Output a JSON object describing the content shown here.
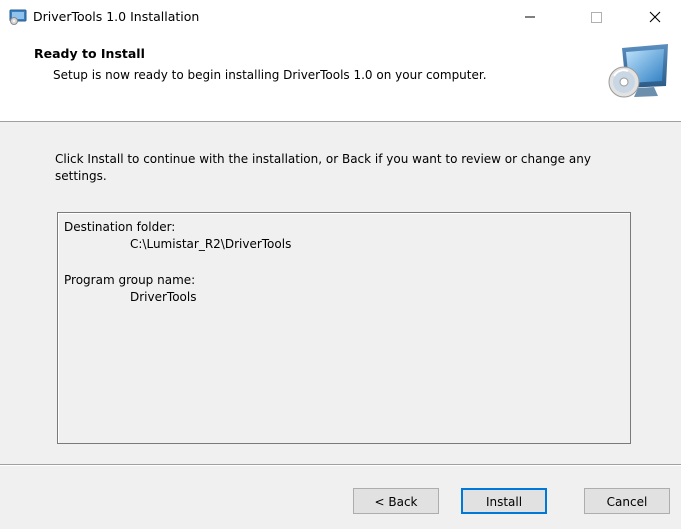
{
  "window": {
    "title": "DriverTools 1.0 Installation",
    "icons": {
      "app": "installer-computer-icon",
      "minimize": "minimize-icon",
      "maximize": "maximize-icon",
      "close": "close-icon"
    }
  },
  "header": {
    "title": "Ready to Install",
    "subtitle": "Setup is now ready to begin installing DriverTools 1.0 on your computer.",
    "graphic": "computer-disc-icon"
  },
  "body": {
    "intro": "Click Install to continue with the installation, or Back if you want to review or change any settings.",
    "memo": {
      "destination_label": "Destination folder:",
      "destination_value": "C:\\Lumistar_R2\\DriverTools",
      "group_label": "Program group name:",
      "group_value": "DriverTools"
    }
  },
  "buttons": {
    "back": "< Back",
    "install": "Install",
    "cancel": "Cancel"
  },
  "colors": {
    "accent": "#0078d7",
    "panel": "#f0f0f0",
    "header": "#ffffff"
  }
}
